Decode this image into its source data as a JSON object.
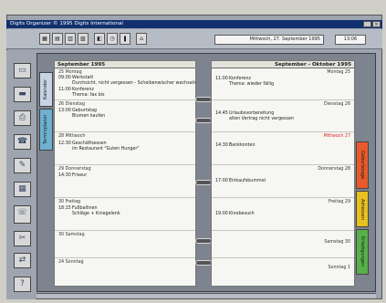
{
  "window": {
    "title": "Digits Organizer © 1995 Digits International"
  },
  "toolbar": {
    "date_field": "Mittwoch, 27. September 1995",
    "time_field": "13:06",
    "buttons": [
      "",
      "",
      "",
      "",
      "",
      "",
      "",
      ""
    ]
  },
  "left_page": {
    "header": "September 1995",
    "tabs": [
      "Kalender",
      "Terminplaner"
    ],
    "days": [
      {
        "label": "25 Montag",
        "events": [
          {
            "time": "09:00",
            "title": "Werkstatt",
            "note": "Durchsicht, nicht vergessen - Scheibenwischer wechseln"
          },
          {
            "time": "11:00",
            "title": "Konferenz",
            "note": "Thema: fax bis"
          }
        ]
      },
      {
        "label": "26 Dienstag",
        "events": [
          {
            "time": "13:00",
            "title": "Geburtstag",
            "note": "Blumen kaufen"
          }
        ]
      },
      {
        "label": "28 Mittwoch",
        "events": [
          {
            "time": "12:30",
            "title": "Geschäftsessen",
            "note": "im Restaurant \"Guten Hunger\""
          }
        ]
      },
      {
        "label": "29 Donnerstag",
        "events": [
          {
            "time": "14:30",
            "title": "Friseur",
            "note": ""
          }
        ]
      },
      {
        "label": "30 Freitag",
        "events": [
          {
            "time": "18:15",
            "title": "Fußballinen",
            "note": "Schläge + Kniegelenk"
          }
        ]
      },
      {
        "label": "30 Samstag",
        "events": []
      },
      {
        "label": "24 Sonntag",
        "events": []
      }
    ]
  },
  "right_page": {
    "header": "September - Oktober 1995",
    "tabs": [
      "Geburtstage",
      "Adressen",
      "Erledigungen"
    ],
    "days": [
      {
        "label": "Montag 25",
        "today": false,
        "events": [
          {
            "time": "11:00",
            "title": "Konferenz",
            "note": "Thema: wieder fällig"
          }
        ]
      },
      {
        "label": "Dienstag 26",
        "today": false,
        "events": [
          {
            "time": "14:45",
            "title": "Urlaubsvorbereitung",
            "note": "alten Vertrag nicht vergessen"
          }
        ]
      },
      {
        "label": "Mittwoch 27",
        "today": true,
        "events": [
          {
            "time": "14:30",
            "title": "Bankkonten",
            "note": ""
          }
        ]
      },
      {
        "label": "Donnerstag 28",
        "today": false,
        "events": [
          {
            "time": "17:00",
            "title": "Einkaufsbummel",
            "note": ""
          }
        ]
      },
      {
        "label": "Freitag 29",
        "today": false,
        "events": [
          {
            "time": "19:00",
            "title": "Kinobesuch",
            "note": ""
          }
        ]
      },
      {
        "label": "Samstag 30",
        "today": false,
        "events": []
      },
      {
        "label": "Sonntag 1",
        "today": false,
        "events": []
      }
    ]
  },
  "colors": {
    "title_bar": "#11306e",
    "today_label": "#dd2222",
    "tab_geburtstage": "#e85a2b",
    "tab_adressen": "#e8c020",
    "tab_erledigungen": "#58b04a",
    "tab_kalender": "#c8d4e6",
    "tab_terminplaner": "#6fb0d0"
  },
  "icons": [
    "folder-open-icon",
    "folder-icon",
    "print-icon",
    "address-book-icon",
    "note-icon",
    "calculator-icon",
    "phone-icon",
    "link-icon",
    "help-icon"
  ]
}
